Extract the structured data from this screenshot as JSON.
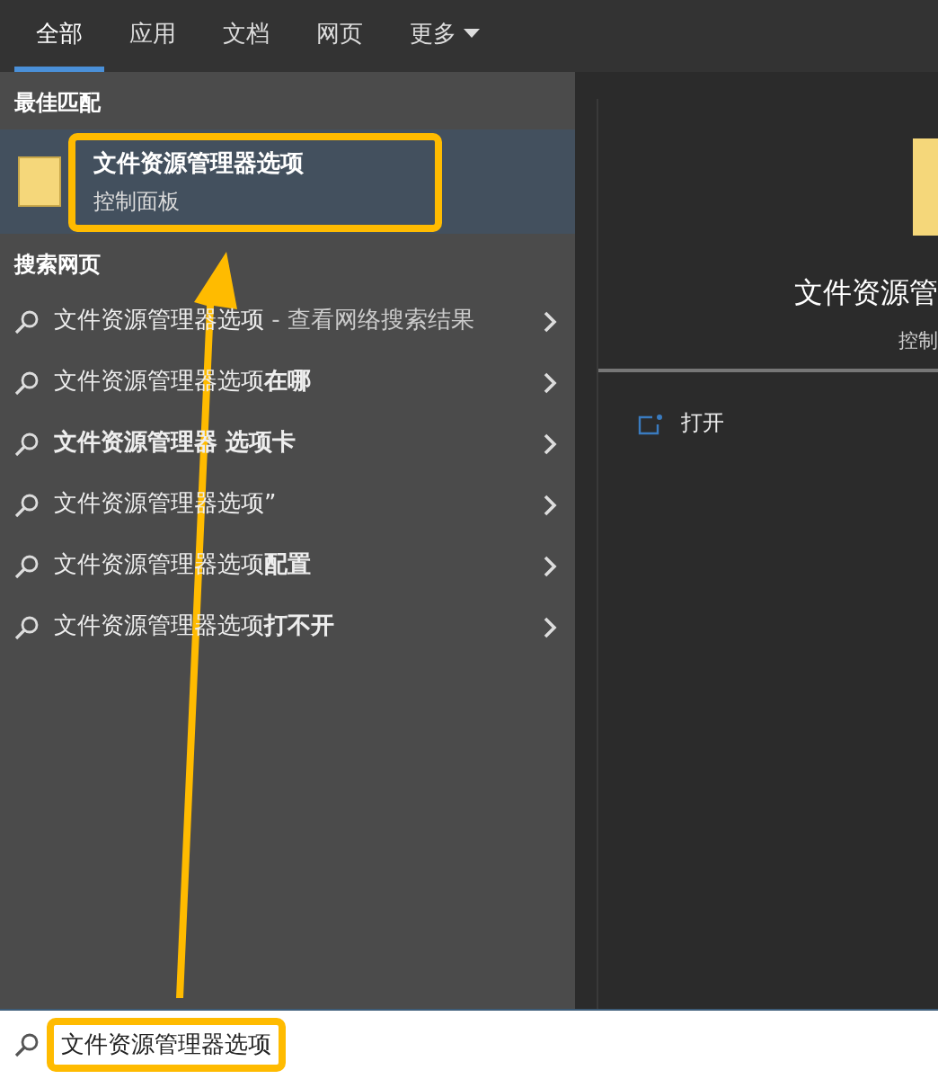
{
  "tabs": [
    {
      "label": "全部",
      "selected": true
    },
    {
      "label": "应用",
      "selected": false
    },
    {
      "label": "文档",
      "selected": false
    },
    {
      "label": "网页",
      "selected": false
    },
    {
      "label": "更多",
      "selected": false,
      "dropdown": true
    }
  ],
  "best_match": {
    "heading": "最佳匹配",
    "title": "文件资源管理器选项",
    "subtitle": "控制面板",
    "highlighted": true
  },
  "web_search": {
    "heading": "搜索网页",
    "items": [
      {
        "text": "文件资源管理器选项",
        "suffix": " - 查看网络搜索结果"
      },
      {
        "text": "文件资源管理器选项**在哪**"
      },
      {
        "text": "**文件资源管理器 选项卡**"
      },
      {
        "text": "文件资源管理器选项”"
      },
      {
        "text": "文件资源管理器选项**配置**"
      },
      {
        "text": "文件资源管理器选项**打不开**"
      }
    ]
  },
  "preview": {
    "title": "文件资源管",
    "subtitle": "控制",
    "actions": [
      {
        "label": "打开"
      }
    ]
  },
  "search_box": {
    "value": "文件资源管理器选项",
    "highlighted": true
  }
}
